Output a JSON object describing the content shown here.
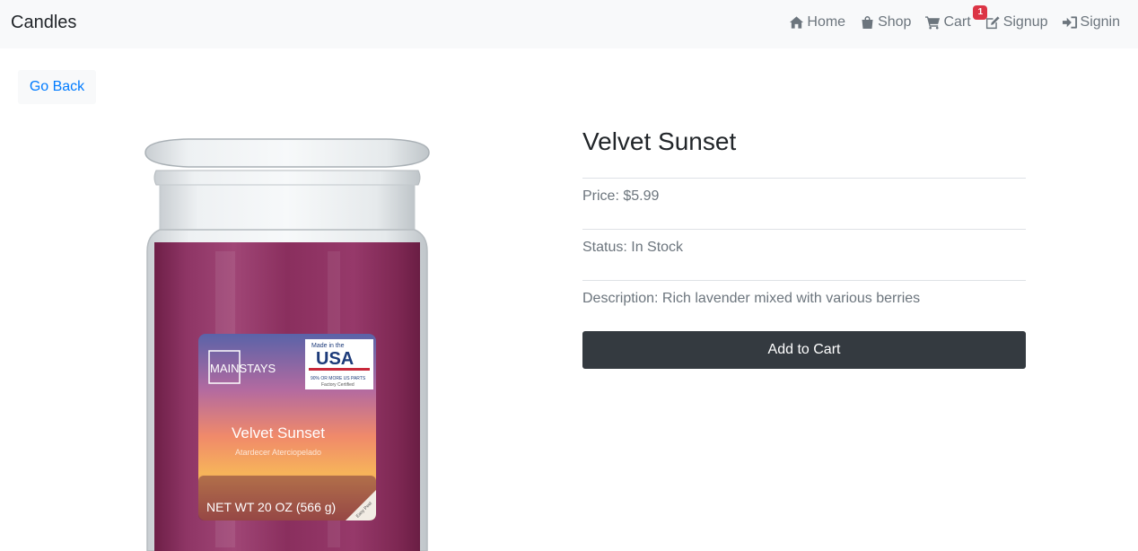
{
  "navbar": {
    "brand": "Candles",
    "links": [
      {
        "label": "Home",
        "icon": "home-icon"
      },
      {
        "label": "Shop",
        "icon": "shopping-bag-icon"
      },
      {
        "label": "Cart",
        "icon": "shopping-cart-icon"
      },
      {
        "label": "Signup",
        "icon": "edit-icon"
      },
      {
        "label": "Signin",
        "icon": "sign-in-icon"
      }
    ],
    "cart_count": "1"
  },
  "back_button": "Go Back",
  "product": {
    "name": "Velvet Sunset",
    "price_label": "Price: $5.99",
    "status_label": "Status: In Stock",
    "description_label": "Description: Rich lavender mixed with various berries",
    "add_to_cart": "Add to Cart",
    "image_label": {
      "brand": "MAINSTAYS",
      "badge_top": "Made in the",
      "badge_main": "USA",
      "badge_sub": "90% OR MORE US PARTS",
      "badge_sub2": "Factory Certified",
      "scent": "Velvet Sunset",
      "scent_sub": "Atardecer Aterciopelado",
      "weight": "NET WT 20 OZ (566 g)",
      "peel": "Easy Peel"
    }
  },
  "colors": {
    "navbar_bg": "#f8f9fa",
    "link": "#007bff",
    "muted": "#6c757d",
    "badge": "#dc3545",
    "button_dark": "#343a40",
    "candle_wax": "#8a2f5e"
  }
}
